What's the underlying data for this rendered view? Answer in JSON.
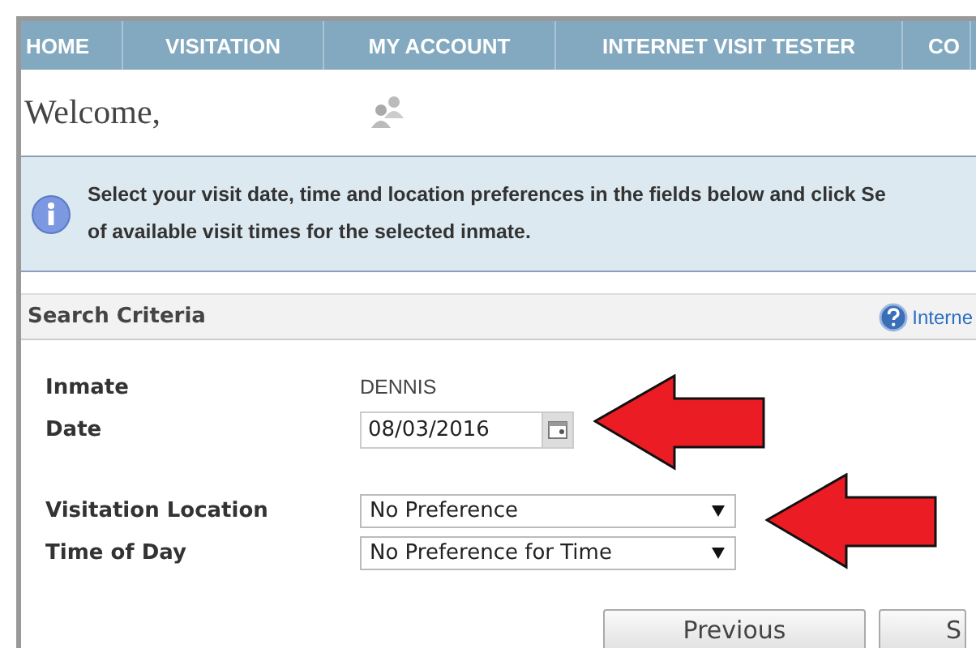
{
  "nav": {
    "items": [
      {
        "label": "HOME",
        "selected": false
      },
      {
        "label": "VISITATION",
        "selected": false
      },
      {
        "label": "MY ACCOUNT",
        "selected": false
      },
      {
        "label": "INTERNET VISIT TESTER",
        "selected": false
      },
      {
        "label": "CO",
        "selected": false
      }
    ]
  },
  "welcome": "Welcome,",
  "info": {
    "lines": [
      "Select your visit date, time and location preferences in the fields below and click Se",
      "of available visit times for the selected inmate."
    ]
  },
  "search": {
    "title": "Search Criteria",
    "help_link": "Interne",
    "fields": [
      {
        "kind": "text",
        "label": "Inmate",
        "value": "DENNIS"
      },
      {
        "kind": "date",
        "label": "Date",
        "value": "08/03/2016"
      },
      {
        "kind": "select",
        "label": "Visitation Location",
        "value": "No Preference"
      },
      {
        "kind": "select",
        "label": "Time of Day",
        "value": "No Preference for Time"
      }
    ],
    "buttons": [
      "Previous",
      "S"
    ]
  }
}
